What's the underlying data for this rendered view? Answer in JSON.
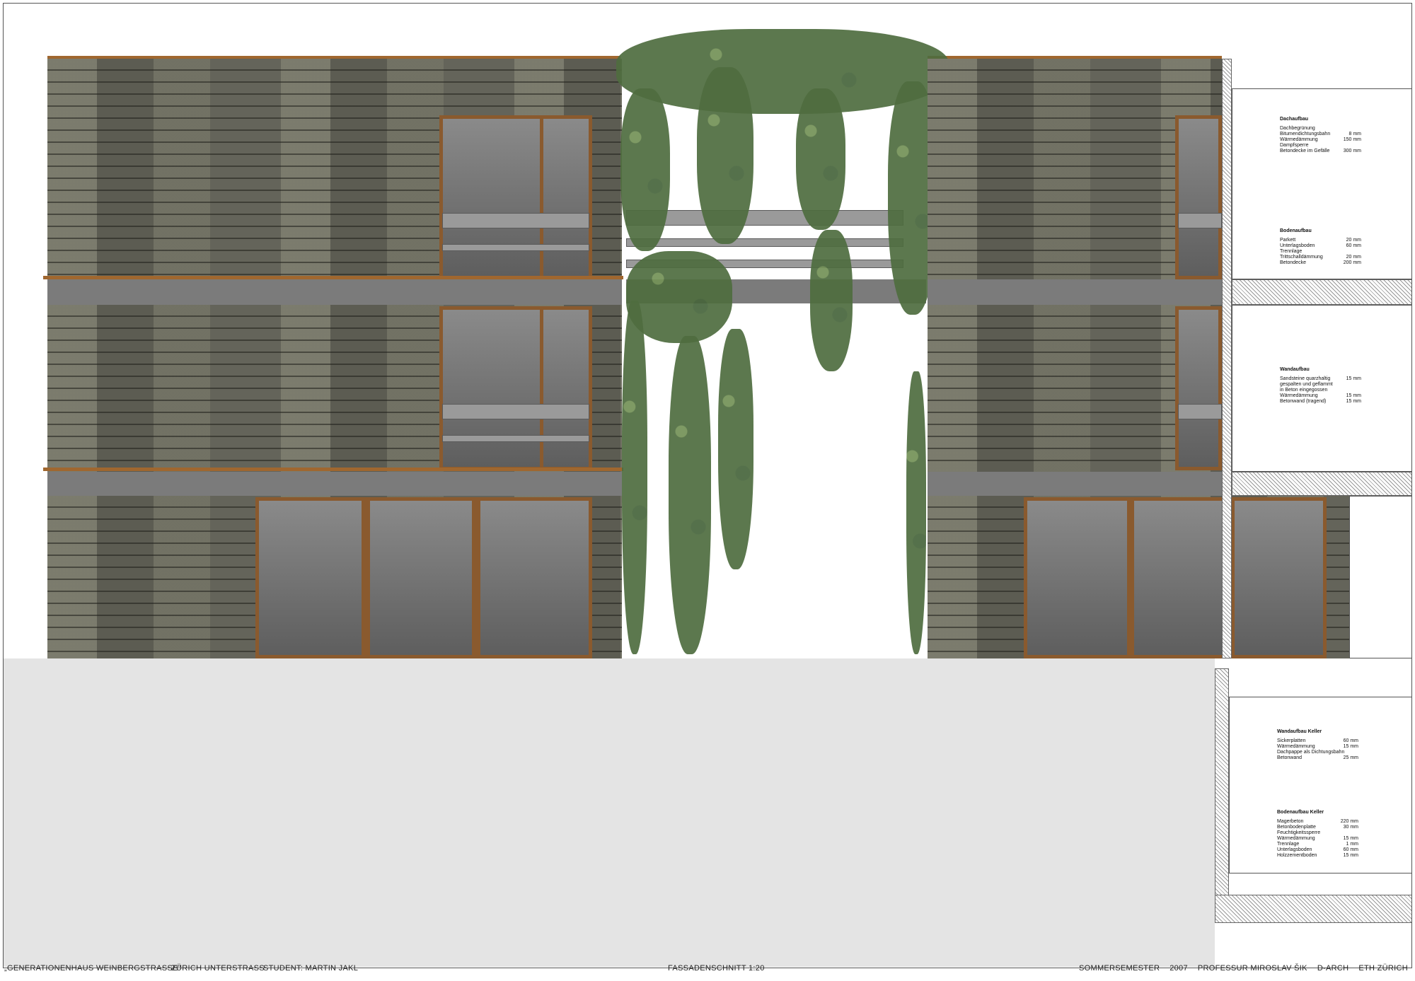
{
  "footer": {
    "project": "„GENERATIONENHAUS WEINBERGSTRASSE\"",
    "location": "ZÜRICH UNTERSTRASS",
    "student": "STUDENT: MARTIN JAKL",
    "drawing": "FASSADENSCHNITT 1:20",
    "semester": "SOMMERSEMESTER",
    "year": "2007",
    "professor": "PROFESSUR MIROSLAV ŠIK",
    "department": "D-ARCH",
    "school": "ETH ZÜRICH"
  },
  "notes": [
    {
      "title": "Dachaufbau",
      "rows": [
        {
          "label": "Dachbegrünung",
          "value": ""
        },
        {
          "label": "Bitumendichtungsbahn",
          "value": "8 mm"
        },
        {
          "label": "Wärmedämmung",
          "value": "150 mm"
        },
        {
          "label": "Dampfsperre",
          "value": ""
        },
        {
          "label": "Betondecke im Gefälle",
          "value": "300 mm"
        }
      ]
    },
    {
      "title": "Bodenaufbau",
      "rows": [
        {
          "label": "Parkett",
          "value": "20 mm"
        },
        {
          "label": "Unterlagsboden",
          "value": "60 mm"
        },
        {
          "label": "Trennlage",
          "value": ""
        },
        {
          "label": "Trittschalldämmung",
          "value": "20 mm"
        },
        {
          "label": "Betondecke",
          "value": "200 mm"
        }
      ]
    },
    {
      "title": "Wandaufbau",
      "rows": [
        {
          "label": "Sandsteine quarzhaltig",
          "value": "15 mm"
        },
        {
          "label": "gespalten und geflammt",
          "value": ""
        },
        {
          "label": "in Beton eingegossen",
          "value": ""
        },
        {
          "label": "Wärmedämmung",
          "value": "15 mm"
        },
        {
          "label": "Betonwand (tragend)",
          "value": "15 mm"
        }
      ]
    },
    {
      "title": "Wandaufbau Keller",
      "rows": [
        {
          "label": "Sickerplatten",
          "value": "60 mm"
        },
        {
          "label": "Wärmedämmung",
          "value": "15 mm"
        },
        {
          "label": "Dachpappe als Dichtungsbahn",
          "value": ""
        },
        {
          "label": "Betonwand",
          "value": "25 mm"
        }
      ]
    },
    {
      "title": "Bodenaufbau Keller",
      "rows": [
        {
          "label": "Magerbeton",
          "value": "220 mm"
        },
        {
          "label": "Betonbodenplatte",
          "value": "30 mm"
        },
        {
          "label": "Feuchtigkeitssperre",
          "value": ""
        },
        {
          "label": "Wärmedämmung",
          "value": "15 mm"
        },
        {
          "label": "Trennlage",
          "value": "1 mm"
        },
        {
          "label": "Unterlagsboden",
          "value": "60 mm"
        },
        {
          "label": "Holzzementboden",
          "value": "15 mm"
        }
      ]
    }
  ]
}
